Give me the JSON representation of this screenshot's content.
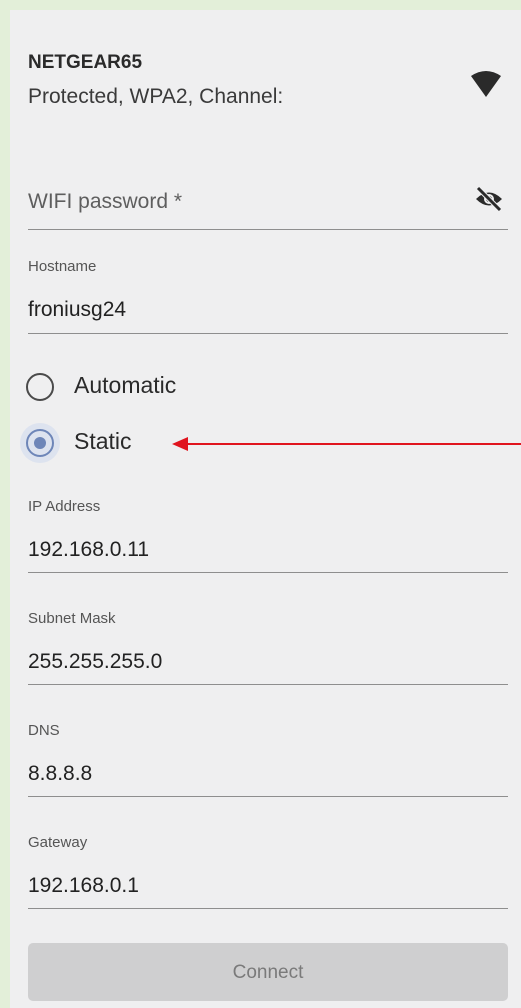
{
  "network": {
    "name": "NETGEAR65",
    "description": "Protected, WPA2, Channel:",
    "signal_icon": "wifi-icon"
  },
  "password": {
    "placeholder": "WIFI password *",
    "value": "",
    "toggle_icon": "eye-off-icon"
  },
  "hostname": {
    "label": "Hostname",
    "value": "froniusg24"
  },
  "ip_mode": {
    "options": [
      {
        "label": "Automatic",
        "selected": false
      },
      {
        "label": "Static",
        "selected": true
      }
    ]
  },
  "ip_address": {
    "label": "IP Address",
    "value": "192.168.0.11"
  },
  "subnet_mask": {
    "label": "Subnet Mask",
    "value": "255.255.255.0"
  },
  "dns": {
    "label": "DNS",
    "value": "8.8.8.8"
  },
  "gateway": {
    "label": "Gateway",
    "value": "192.168.0.1"
  },
  "connect_button": {
    "label": "Connect",
    "enabled": false
  },
  "colors": {
    "background": "#e3efd9",
    "panel": "#efeff0",
    "radio_selected": "#6e86b8",
    "annotation_arrow": "#e0141e",
    "button_disabled": "#cfcfd0"
  }
}
